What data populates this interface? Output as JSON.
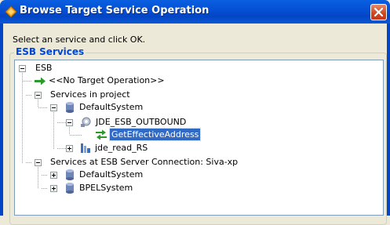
{
  "window": {
    "title": "Browse Target Service Operation"
  },
  "instruction": "Select an service and click OK.",
  "group": {
    "title": "ESB Services"
  },
  "tree": {
    "root": "ESB",
    "no_target": "<<No Target Operation>>",
    "services_in_project": "Services in project",
    "default_system": "DefaultSystem",
    "jde_esb_outbound": "JDE_ESB_OUTBOUND",
    "get_effective_address": "GetEffectiveAddress",
    "jde_read_rs": "jde_read_RS",
    "server_connection": "Services at ESB Server Connection: Siva-xp",
    "server_default_system": "DefaultSystem",
    "bpel_system": "BPELSystem"
  },
  "colors": {
    "title_blue": "#0345c4",
    "selection": "#316ac5",
    "group_title": "#0046d5"
  }
}
